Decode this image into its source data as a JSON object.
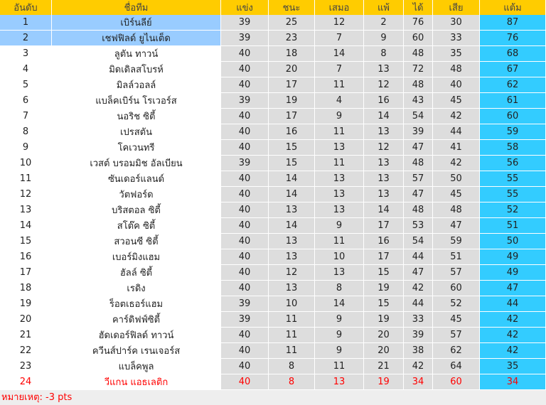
{
  "headers": [
    "อันดับ",
    "ชื่อทีม",
    "แข่ง",
    "ชนะ",
    "เสมอ",
    "แพ้",
    "ได้",
    "เสีย",
    "แต้ม"
  ],
  "rows": [
    {
      "pos": "1",
      "team": "เบิร์นลีย์",
      "p": "39",
      "w": "25",
      "d": "12",
      "l": "2",
      "gf": "76",
      "ga": "30",
      "pts": "87",
      "status": "promo"
    },
    {
      "pos": "2",
      "team": "เชฟฟิลด์ ยูไนเต็ด",
      "p": "39",
      "w": "23",
      "d": "7",
      "l": "9",
      "gf": "60",
      "ga": "33",
      "pts": "76",
      "status": "promo"
    },
    {
      "pos": "3",
      "team": "ลูตัน ทาวน์",
      "p": "40",
      "w": "18",
      "d": "14",
      "l": "8",
      "gf": "48",
      "ga": "35",
      "pts": "68",
      "status": ""
    },
    {
      "pos": "4",
      "team": "มิดเดิลสโบรห์",
      "p": "40",
      "w": "20",
      "d": "7",
      "l": "13",
      "gf": "72",
      "ga": "48",
      "pts": "67",
      "status": ""
    },
    {
      "pos": "5",
      "team": "มิลล์วอลล์",
      "p": "40",
      "w": "17",
      "d": "11",
      "l": "12",
      "gf": "48",
      "ga": "40",
      "pts": "62",
      "status": ""
    },
    {
      "pos": "6",
      "team": "แบล็คเบิร์น โรเวอร์ส",
      "p": "39",
      "w": "19",
      "d": "4",
      "l": "16",
      "gf": "43",
      "ga": "45",
      "pts": "61",
      "status": ""
    },
    {
      "pos": "7",
      "team": "นอริช ซิตี้",
      "p": "40",
      "w": "17",
      "d": "9",
      "l": "14",
      "gf": "54",
      "ga": "42",
      "pts": "60",
      "status": ""
    },
    {
      "pos": "8",
      "team": "เปรสตัน",
      "p": "40",
      "w": "16",
      "d": "11",
      "l": "13",
      "gf": "39",
      "ga": "44",
      "pts": "59",
      "status": ""
    },
    {
      "pos": "9",
      "team": "โคเวนทรี",
      "p": "40",
      "w": "15",
      "d": "13",
      "l": "12",
      "gf": "47",
      "ga": "41",
      "pts": "58",
      "status": ""
    },
    {
      "pos": "10",
      "team": "เวสต์ บรอมมิช อัลเบียน",
      "p": "39",
      "w": "15",
      "d": "11",
      "l": "13",
      "gf": "48",
      "ga": "42",
      "pts": "56",
      "status": ""
    },
    {
      "pos": "11",
      "team": "ซันเดอร์แลนด์",
      "p": "40",
      "w": "14",
      "d": "13",
      "l": "13",
      "gf": "57",
      "ga": "50",
      "pts": "55",
      "status": ""
    },
    {
      "pos": "12",
      "team": "วัตฟอร์ด",
      "p": "40",
      "w": "14",
      "d": "13",
      "l": "13",
      "gf": "47",
      "ga": "45",
      "pts": "55",
      "status": ""
    },
    {
      "pos": "13",
      "team": "บริสตอล ซิตี้",
      "p": "40",
      "w": "13",
      "d": "13",
      "l": "14",
      "gf": "48",
      "ga": "48",
      "pts": "52",
      "status": ""
    },
    {
      "pos": "14",
      "team": "สโต๊ค ซิตี้",
      "p": "40",
      "w": "14",
      "d": "9",
      "l": "17",
      "gf": "53",
      "ga": "47",
      "pts": "51",
      "status": ""
    },
    {
      "pos": "15",
      "team": "สวอนซี ซิตี้",
      "p": "40",
      "w": "13",
      "d": "11",
      "l": "16",
      "gf": "54",
      "ga": "59",
      "pts": "50",
      "status": ""
    },
    {
      "pos": "16",
      "team": "เบอร์มิงแฮม",
      "p": "40",
      "w": "13",
      "d": "10",
      "l": "17",
      "gf": "44",
      "ga": "51",
      "pts": "49",
      "status": ""
    },
    {
      "pos": "17",
      "team": "ฮัลล์ ซิตี้",
      "p": "40",
      "w": "12",
      "d": "13",
      "l": "15",
      "gf": "47",
      "ga": "57",
      "pts": "49",
      "status": ""
    },
    {
      "pos": "18",
      "team": "เรดิง",
      "p": "40",
      "w": "13",
      "d": "8",
      "l": "19",
      "gf": "42",
      "ga": "60",
      "pts": "47",
      "status": ""
    },
    {
      "pos": "19",
      "team": "ร็อตเธอร์แฮม",
      "p": "39",
      "w": "10",
      "d": "14",
      "l": "15",
      "gf": "44",
      "ga": "52",
      "pts": "44",
      "status": ""
    },
    {
      "pos": "20",
      "team": "คาร์ดิฟฟ์ซิตี้",
      "p": "39",
      "w": "11",
      "d": "9",
      "l": "19",
      "gf": "33",
      "ga": "45",
      "pts": "42",
      "status": ""
    },
    {
      "pos": "21",
      "team": "ฮัดเดอร์ฟิลด์ ทาวน์",
      "p": "40",
      "w": "11",
      "d": "9",
      "l": "20",
      "gf": "39",
      "ga": "57",
      "pts": "42",
      "status": ""
    },
    {
      "pos": "22",
      "team": "ควีนส์ปาร์ค เรนเจอร์ส",
      "p": "40",
      "w": "11",
      "d": "9",
      "l": "20",
      "gf": "38",
      "ga": "62",
      "pts": "42",
      "status": ""
    },
    {
      "pos": "23",
      "team": "แบล็คพูล",
      "p": "40",
      "w": "8",
      "d": "11",
      "l": "21",
      "gf": "42",
      "ga": "64",
      "pts": "35",
      "status": ""
    },
    {
      "pos": "24",
      "team": "วีแกน แอธเลติก",
      "p": "40",
      "w": "8",
      "d": "13",
      "l": "19",
      "gf": "34",
      "ga": "60",
      "pts": "34",
      "status": "releg"
    }
  ],
  "note": "หมายเหตุ: -3 pts",
  "colors": {
    "header": "#ffcc00",
    "promo": "#99ccff",
    "stat": "#dddddd",
    "points": "#33ccff",
    "relegated_text": "#ff0000"
  }
}
